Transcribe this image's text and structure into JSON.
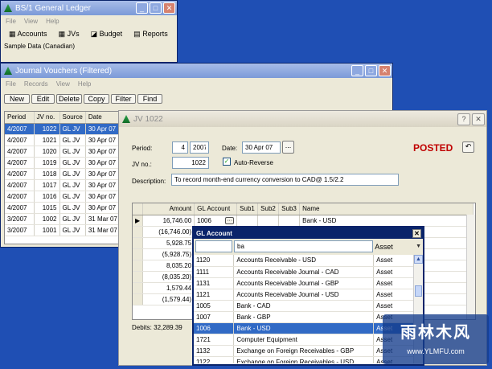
{
  "gl": {
    "title": "BS/1 General Ledger",
    "menu": [
      "File",
      "View",
      "Help"
    ],
    "toolbar": [
      "Accounts",
      "JVs",
      "Budget",
      "Reports"
    ],
    "status": "Sample Data (Canadian)"
  },
  "jvlist": {
    "title": "Journal Vouchers (Filtered)",
    "menu": [
      "File",
      "Records",
      "View",
      "Help"
    ],
    "buttons": [
      "New",
      "Edit",
      "Delete",
      "Copy",
      "Filter",
      "Find"
    ],
    "headers": [
      "Period",
      "JV no.",
      "Source",
      "Date"
    ],
    "rows": [
      [
        "4/2007",
        "1022",
        "GL JV",
        "30 Apr 07"
      ],
      [
        "4/2007",
        "1021",
        "GL JV",
        "30 Apr 07"
      ],
      [
        "4/2007",
        "1020",
        "GL JV",
        "30 Apr 07"
      ],
      [
        "4/2007",
        "1019",
        "GL JV",
        "30 Apr 07"
      ],
      [
        "4/2007",
        "1018",
        "GL JV",
        "30 Apr 07"
      ],
      [
        "4/2007",
        "1017",
        "GL JV",
        "30 Apr 07"
      ],
      [
        "4/2007",
        "1016",
        "GL JV",
        "30 Apr 07"
      ],
      [
        "4/2007",
        "1015",
        "GL JV",
        "30 Apr 07"
      ],
      [
        "3/2007",
        "1002",
        "GL JV",
        "31 Mar 07"
      ],
      [
        "3/2007",
        "1001",
        "GL JV",
        "31 Mar 07"
      ]
    ]
  },
  "jv": {
    "title": "JV 1022",
    "period_label": "Period:",
    "period_num": "4",
    "period_year": "2007",
    "date_label": "Date:",
    "date": "30 Apr 07",
    "date_btn": "...",
    "jvno_label": "JV no.:",
    "jvno": "1022",
    "auto_reverse": "Auto-Reverse",
    "posted": "POSTED",
    "desc_label": "Description:",
    "desc": "To record month-end currency conversion to CAD@ 1.5/2.2",
    "headers": [
      "Amount",
      "GL Account",
      "Sub1",
      "Sub2",
      "Sub3",
      "Name"
    ],
    "rows": [
      [
        "16,746.00",
        "1006",
        "Bank - USD"
      ],
      [
        "(16,746.00)",
        "",
        ""
      ],
      [
        "5,928.75",
        "",
        ""
      ],
      [
        "(5,928.75)",
        "",
        ""
      ],
      [
        "8,035.20",
        "",
        ""
      ],
      [
        "(8,035.20)",
        "",
        ""
      ],
      [
        "1,579.44",
        "",
        ""
      ],
      [
        "(1,579.44)",
        "",
        ""
      ]
    ],
    "debits": "Debits: 32,289.39",
    "credits_partial": "C"
  },
  "glacct": {
    "title": "GL Account",
    "search": "ba",
    "type_filter": "Asset",
    "rows": [
      [
        "1120",
        "Accounts Receivable - USD",
        "Asset"
      ],
      [
        "1111",
        "Accounts Receivable Journal - CAD",
        "Asset"
      ],
      [
        "1131",
        "Accounts Receivable Journal - GBP",
        "Asset"
      ],
      [
        "1121",
        "Accounts Receivable Journal - USD",
        "Asset"
      ],
      [
        "1005",
        "Bank - CAD",
        "Asset"
      ],
      [
        "1007",
        "Bank - GBP",
        "Asset"
      ],
      [
        "1006",
        "Bank - USD",
        "Asset"
      ],
      [
        "1721",
        "Computer Equipment",
        "Asset"
      ],
      [
        "1132",
        "Exchange on Foreign Receivables - GBP",
        "Asset"
      ],
      [
        "1122",
        "Exchange on Foreign Receivables - USD",
        "Asset"
      ]
    ],
    "selected": 6
  },
  "watermark": {
    "text": "雨林木风",
    "url": "www.YLMFU.com"
  },
  "colors": {
    "title_active": "#1a5ad6",
    "selection": "#316ac5",
    "posted": "#c00000",
    "desktop": "#1f4fb4"
  }
}
